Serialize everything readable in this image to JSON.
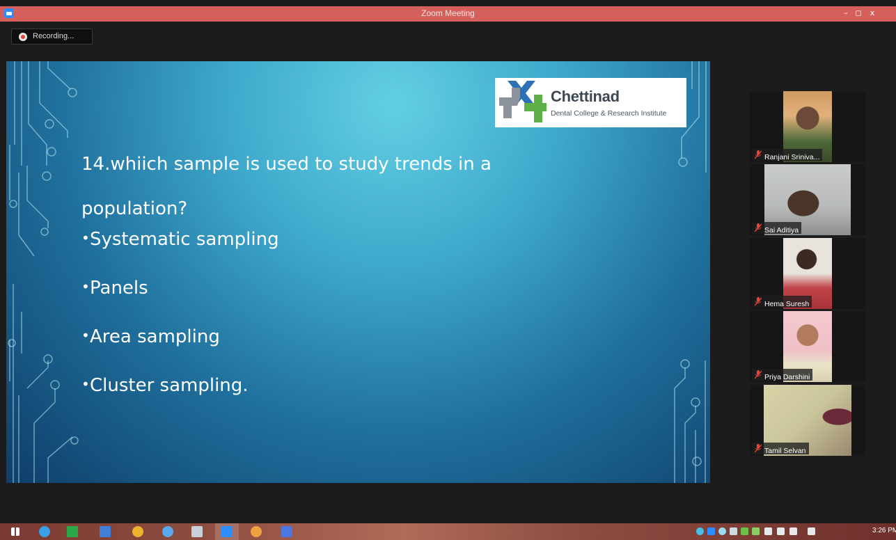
{
  "window": {
    "title": "Zoom Meeting",
    "minimize": "–",
    "restore": "◻",
    "close": "x"
  },
  "recording": {
    "label": "Recording..."
  },
  "slide": {
    "logo": {
      "brand": "Chettinad",
      "subtitle": "Dental College & Research Institute"
    },
    "question_line1": "14.whiich sample is used to study trends in a",
    "question_line2": "population?",
    "options": [
      "Systematic sampling",
      "Panels",
      "Area sampling",
      "Cluster sampling."
    ]
  },
  "participants": [
    {
      "name": "Ranjani Sriniva..."
    },
    {
      "name": "Sai Aditiya"
    },
    {
      "name": "Hema Suresh"
    },
    {
      "name": "Priya Darshini"
    },
    {
      "name": "Tamil Selvan"
    }
  ],
  "taskbar": {
    "clock": "3:26 PM"
  },
  "colors": {
    "titlebar": "#d5605b",
    "slide_light": "#63cfe2",
    "slide_dark": "#0f3e6a",
    "mic_muted": "#e0483e",
    "zoom_blue": "#2d8cff"
  }
}
